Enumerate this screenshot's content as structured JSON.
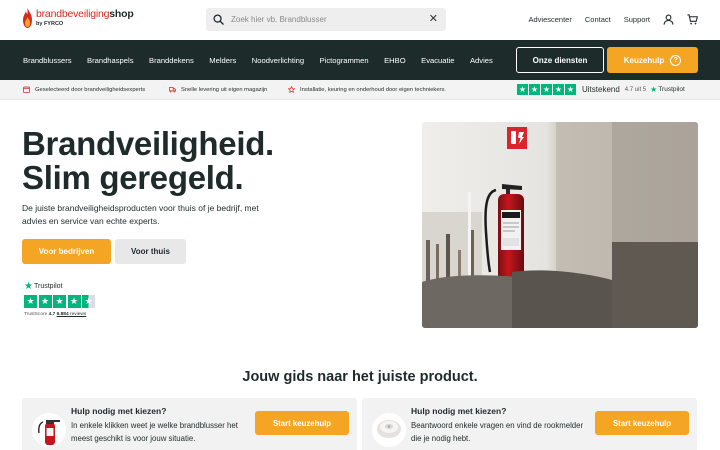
{
  "brand": {
    "logo_part1": "brandbeveiliging",
    "logo_part2": "shop",
    "logo_sub": "by FYRCO"
  },
  "search": {
    "placeholder": "Zoek hier vb. Brandblusser",
    "value": ""
  },
  "top_links": [
    "Adviescenter",
    "Contact",
    "Support"
  ],
  "nav": {
    "items": [
      "Brandblussers",
      "Brandhaspels",
      "Branddekens",
      "Melders",
      "Noodverlichting",
      "Pictogrammen",
      "EHBO",
      "Evacuatie",
      "Advies"
    ],
    "services_label": "Onze diensten",
    "keuzehulp_label": "Keuzehulp",
    "keuzehulp_icon": "?"
  },
  "usps": [
    "Geselecteerd door brandveiligheidsexperts",
    "Snelle levering uit eigen magazijn",
    "Installatie, keuring en onderhoud door eigen techniekers."
  ],
  "trustpilot_strip": {
    "label": "Uitstekend",
    "score_text": "4.7 uit 5",
    "brand": "Trustpilot"
  },
  "hero": {
    "title_line1": "Brandveiligheid.",
    "title_line2": "Slim geregeld.",
    "subtitle": "De juiste brandveiligheidsproducten voor thuis of je bedrijf, met advies en service van echte experts.",
    "btn_business": "Voor bedrijven",
    "btn_home": "Voor thuis"
  },
  "trustpilot_widget": {
    "brand": "Trustpilot",
    "score_label": "TrustScore",
    "score": "4.7",
    "reviews_count": "6.884",
    "reviews_label": "reviews",
    "rating": 4.5
  },
  "guide": {
    "title": "Jouw gids naar het juiste product.",
    "cards": [
      {
        "title": "Hulp nodig met kiezen?",
        "text": "In enkele klikken weet je welke brandblusser het meest geschikt is voor jouw situatie.",
        "button": "Start keuzehulp",
        "icon": "fire-extinguisher-icon"
      },
      {
        "title": "Hulp nodig met kiezen?",
        "text": "Beantwoord enkele vragen en vind de rookmelder die je nodig hebt.",
        "button": "Start keuzehulp",
        "icon": "smoke-detector-icon"
      }
    ]
  },
  "colors": {
    "accent": "#f5a524",
    "navbar": "#1d2b2b",
    "trustpilot_green": "#00b67a",
    "brand_red": "#d52b1e"
  }
}
